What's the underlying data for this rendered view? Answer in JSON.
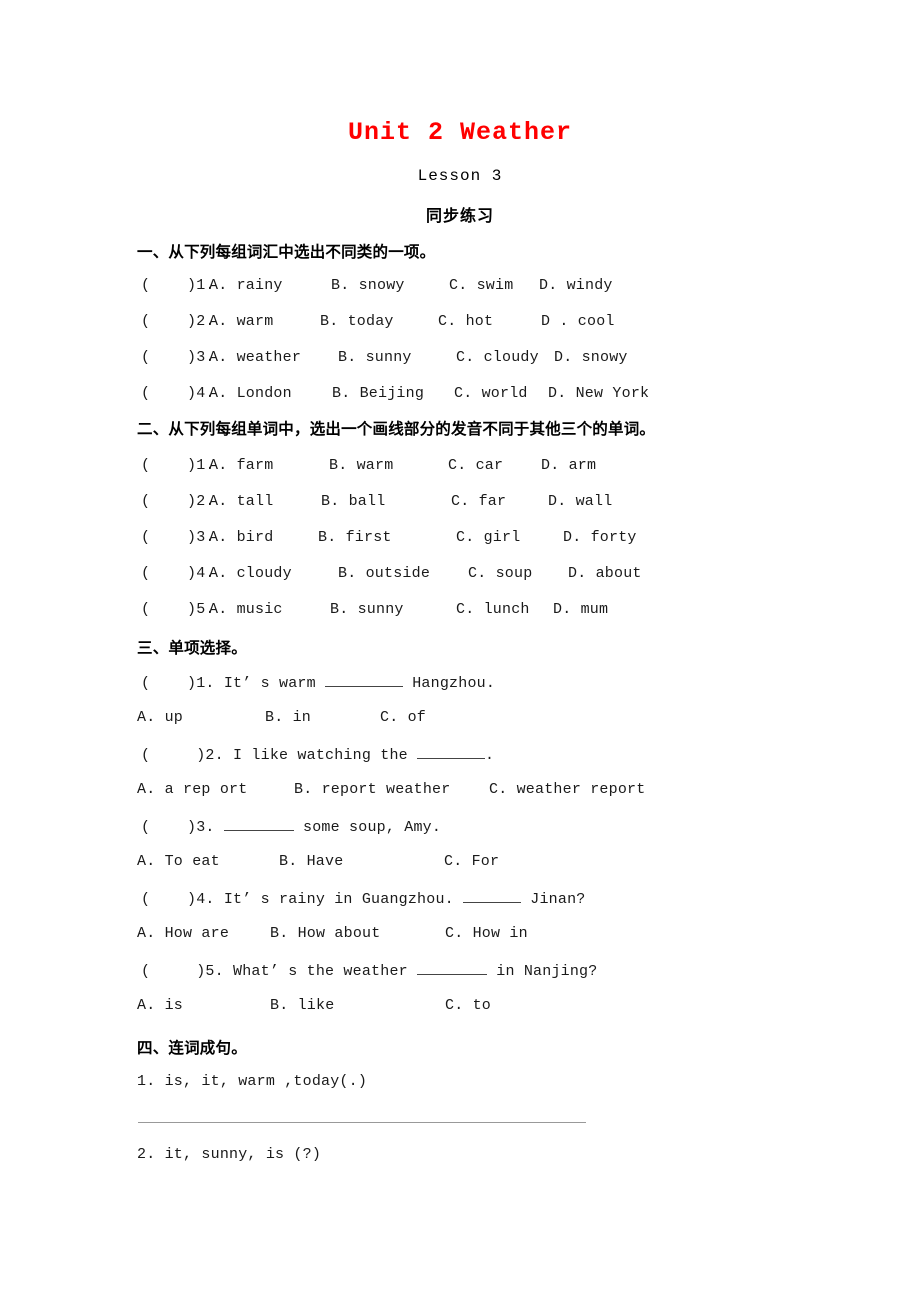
{
  "header": {
    "title": "Unit 2 Weather",
    "lesson": "Lesson 3",
    "practice": "同步练习",
    "title_color": "#ff0000"
  },
  "sections": [
    {
      "heading": "一、从下列每组词汇中选出不同类的一项。",
      "questions": [
        {
          "marker": "(    )1.",
          "options": [
            "A. rainy",
            "B. snowy",
            "C. swim",
            "D. windy"
          ]
        },
        {
          "marker": "(    )2.",
          "options": [
            "A. warm",
            "B. today",
            "C. hot",
            "D . cool"
          ]
        },
        {
          "marker": "(    )3.",
          "options": [
            "A. weather",
            "B. sunny",
            "C. cloudy",
            "D. snowy"
          ]
        },
        {
          "marker": "(    )4.",
          "options": [
            "A. London",
            "B. Beijing",
            "C. world",
            "D. New York"
          ]
        }
      ]
    },
    {
      "heading": "二、从下列每组单词中，选出一个画线部分的发音不同于其他三个的单词。",
      "questions": [
        {
          "marker": "(    )1.",
          "options": [
            "A. farm",
            "B. warm",
            "C. car",
            "D. arm"
          ]
        },
        {
          "marker": "(    )2.",
          "options": [
            "A. tall",
            "B. ball",
            "C. far",
            "D. wall"
          ]
        },
        {
          "marker": "(    )3.",
          "options": [
            "A. bird",
            "B. first",
            "C. girl",
            "D. forty"
          ]
        },
        {
          "marker": "(    )4.",
          "options": [
            "A. cloudy",
            "B. outside",
            "C. soup",
            "D. about"
          ]
        },
        {
          "marker": "(    )5.",
          "options": [
            "A. music",
            "B. sunny",
            "C. lunch",
            "D. mum"
          ]
        }
      ]
    },
    {
      "heading": "三、单项选择。",
      "items": [
        {
          "stem_pre": "(    )1. It’ s warm ",
          "stem_post": " Hangzhou.",
          "choices": [
            "A. up",
            "B. in",
            "C. of"
          ]
        },
        {
          "stem_pre": "(     )2. I like watching the ",
          "stem_post": ".",
          "choices": [
            "A. a rep ort",
            "B. report weather",
            "C. weather report"
          ]
        },
        {
          "stem_pre": "(    )3. ",
          "stem_post": " some soup, Amy.",
          "choices": [
            "A. To eat",
            "B. Have",
            "C. For"
          ]
        },
        {
          "stem_pre": "(    )4. It’ s rainy in Guangzhou. ",
          "stem_post": " Jinan?",
          "choices": [
            "A. How are",
            "B. How about",
            "C. How in"
          ]
        },
        {
          "stem_pre": "(     )5. What’ s the weather ",
          "stem_post": " in Nanjing?",
          "choices": [
            "A. is",
            "B. like",
            "C. to"
          ]
        }
      ]
    },
    {
      "heading": "四、连词成句。",
      "items": [
        {
          "text": "1. is, it, warm ,today(.)"
        },
        {
          "text": "2. it, sunny, is (?)"
        }
      ]
    }
  ]
}
